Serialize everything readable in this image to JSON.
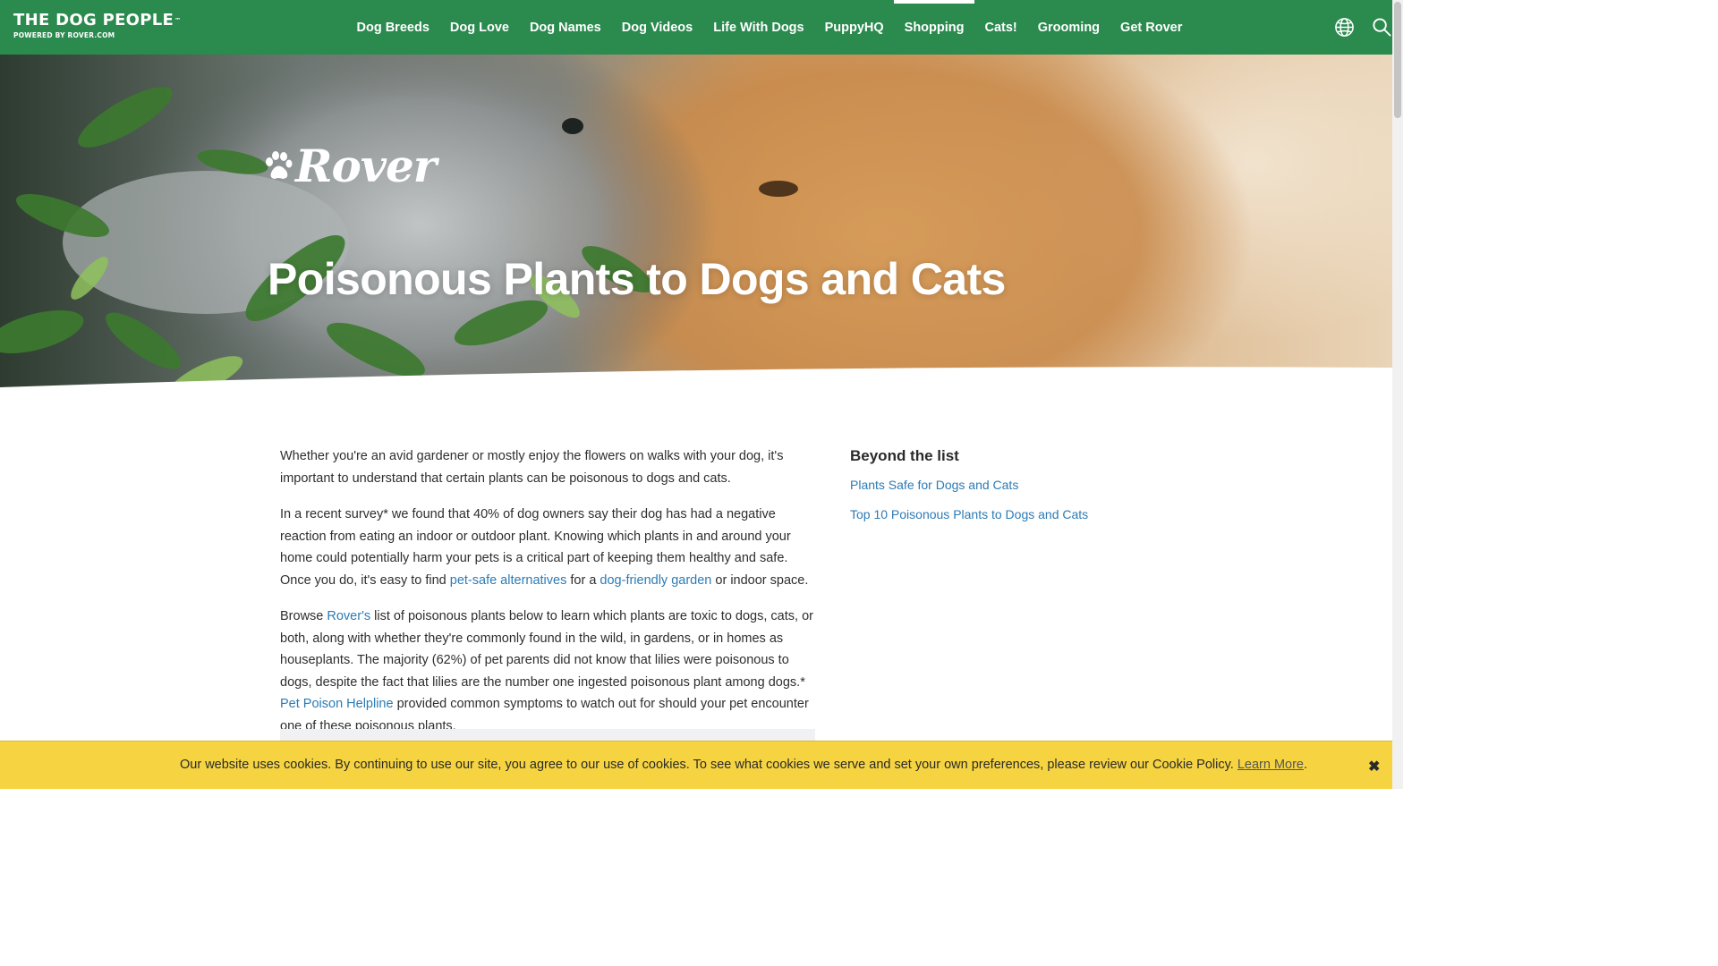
{
  "brand": {
    "title": "THE DOG PEOPLE",
    "trademark": "™",
    "subtitle": "POWERED BY ROVER.COM"
  },
  "nav": {
    "items": [
      {
        "label": "Dog Breeds"
      },
      {
        "label": "Dog Love"
      },
      {
        "label": "Dog Names"
      },
      {
        "label": "Dog Videos"
      },
      {
        "label": "Life With Dogs"
      },
      {
        "label": "PuppyHQ"
      },
      {
        "label": "Shopping",
        "active": true
      },
      {
        "label": "Cats!"
      },
      {
        "label": "Grooming"
      },
      {
        "label": "Get Rover"
      }
    ],
    "globe_icon": "globe-icon",
    "search_icon": "search-icon"
  },
  "hero": {
    "logo_text": "Rover",
    "title": "Poisonous Plants to Dogs and Cats"
  },
  "article": {
    "p1": "Whether you're an avid gardener or mostly enjoy the flowers on walks with your dog, it's important to understand that certain plants can be poisonous to dogs and cats.",
    "p2_a": "In a recent survey* we found that 40% of dog owners say their dog has had a negative reaction from eating an indoor or outdoor plant. Knowing which plants in and around your home could potentially harm your pets is a critical part of keeping them healthy and safe. Once you do, it's easy to find ",
    "p2_link1": "pet-safe alternatives",
    "p2_b": " for a ",
    "p2_link2": "dog-friendly garden",
    "p2_c": " or indoor space.",
    "p3_a": "Browse ",
    "p3_link1": "Rover's",
    "p3_b": " list of poisonous plants below to learn which plants are toxic to dogs, cats, or both, along with whether they're commonly found in the wild, in gardens, or in homes as houseplants. The majority (62%) of pet parents did not know that lilies were poisonous to dogs, despite the fact that lilies are the number one ingested poisonous plant among dogs.* ",
    "p3_link2": "Pet Poison Helpline",
    "p3_c": " provided common symptoms to watch out for should your pet encounter one of these poisonous plants."
  },
  "sidebar": {
    "heading": "Beyond the list",
    "links": [
      {
        "label": "Plants Safe for Dogs and Cats"
      },
      {
        "label": "Top 10 Poisonous Plants to Dogs and Cats"
      }
    ]
  },
  "cookie": {
    "text": "Our website uses cookies. By continuing to use our site, you agree to our use of cookies. To see what cookies we serve and set your own preferences, please review our Cookie Policy. ",
    "link": "Learn More",
    "period": ".",
    "close": "✖"
  },
  "colors": {
    "header_green": "#2b8a4e",
    "link_blue": "#2c7bb5",
    "cookie_yellow": "#f6d441"
  }
}
